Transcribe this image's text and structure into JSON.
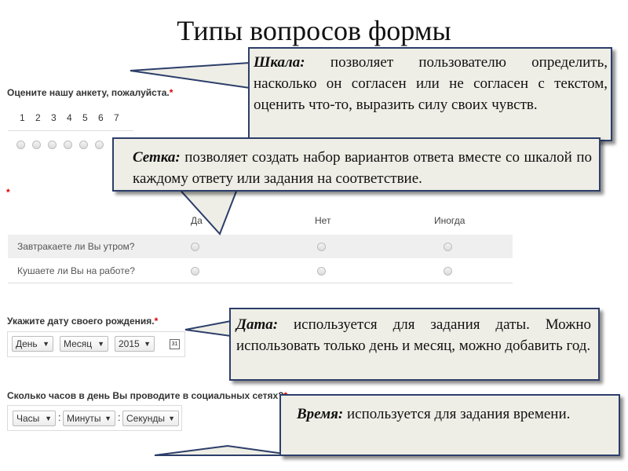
{
  "title": "Типы вопросов формы",
  "scale_question": {
    "label": "Оцените нашу анкету, пожалуйста.",
    "required_mark": "*",
    "numbers": [
      "1",
      "2",
      "3",
      "4",
      "5",
      "6",
      "7"
    ]
  },
  "grid_question": {
    "required_mark": "*",
    "columns": [
      "Да",
      "Нет",
      "Иногда"
    ],
    "rows": [
      "Завтракаете ли Вы утром?",
      "Кушаете ли Вы на работе?"
    ]
  },
  "date_question": {
    "label": "Укажите дату своего рождения.",
    "required_mark": "*",
    "day": "День",
    "month": "Месяц",
    "year": "2015",
    "calendar_icon_text": "31"
  },
  "time_question": {
    "label": "Сколько часов в день Вы проводите в социальных сетях?",
    "required_mark": "*",
    "hours": "Часы",
    "minutes": "Минуты",
    "seconds": "Секунды",
    "separator": ":"
  },
  "callouts": {
    "scale": {
      "term": "Шкала:",
      "text": " позволяет пользователю определить, насколько он согласен или не согласен с текстом, оценить что-то, выразить силу своих чувств."
    },
    "grid": {
      "term": "Сетка:",
      "text": " позволяет создать набор вариантов ответа вместе со шкалой по каждому ответу или задания на соответствие."
    },
    "date": {
      "term": "Дата:",
      "text": " используется для задания даты. Можно использовать только день и месяц, можно добавить год."
    },
    "time": {
      "term": "Время:",
      "text": " используется для задания времени."
    }
  },
  "colors": {
    "callout_fill": "#eeeee6",
    "callout_border": "#2c3e6a",
    "required": "#dd0000"
  }
}
